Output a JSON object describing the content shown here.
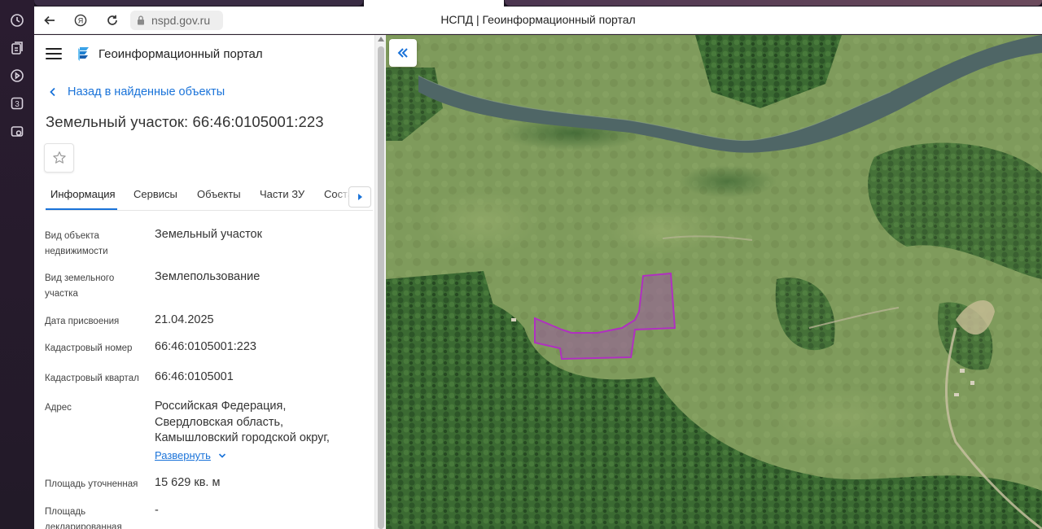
{
  "browser": {
    "url": "nspd.gov.ru",
    "page_title": "НСПД | Геоинформационный портал"
  },
  "header": {
    "portal_name": "Геоинформационный портал"
  },
  "nav": {
    "back_label": "Назад в найденные объекты"
  },
  "object": {
    "title": "Земельный участок: 66:46:0105001:223"
  },
  "tabs": [
    {
      "label": "Информация",
      "active": true
    },
    {
      "label": "Сервисы"
    },
    {
      "label": "Объекты"
    },
    {
      "label": "Части ЗУ"
    },
    {
      "label": "Состав"
    }
  ],
  "properties": [
    {
      "label": "Вид объекта недвижимости",
      "value": "Земельный участок"
    },
    {
      "label": "Вид земельного участка",
      "value": "Землепользование"
    },
    {
      "label": "Дата присвоения",
      "value": "21.04.2025"
    },
    {
      "label": "Кадастровый номер",
      "value": "66:46:0105001:223"
    },
    {
      "label": "Кадастровый квартал",
      "value": "66:46:0105001"
    },
    {
      "label": "Адрес",
      "value": "Российская Федерация, Свердловская область, Камышловский городской округ,"
    },
    {
      "label": "Площадь уточненная",
      "value": "15 629 кв. м"
    },
    {
      "label": "Площадь декларированная",
      "value": "-"
    }
  ],
  "address_expand_label": "Развернуть",
  "colors": {
    "accent": "#1a73d9",
    "parcel_stroke": "#b030c0",
    "parcel_fill": "#9a5aa0"
  },
  "icons": [
    "history-icon",
    "collections-icon",
    "play-icon",
    "badge-3-icon",
    "camera-icon",
    "back-arrow-icon",
    "yandex-icon",
    "reload-icon",
    "lock-icon",
    "menu-icon",
    "logo-icon",
    "chevron-left-icon",
    "star-icon",
    "chevron-down-icon",
    "double-chevron-left-icon"
  ]
}
